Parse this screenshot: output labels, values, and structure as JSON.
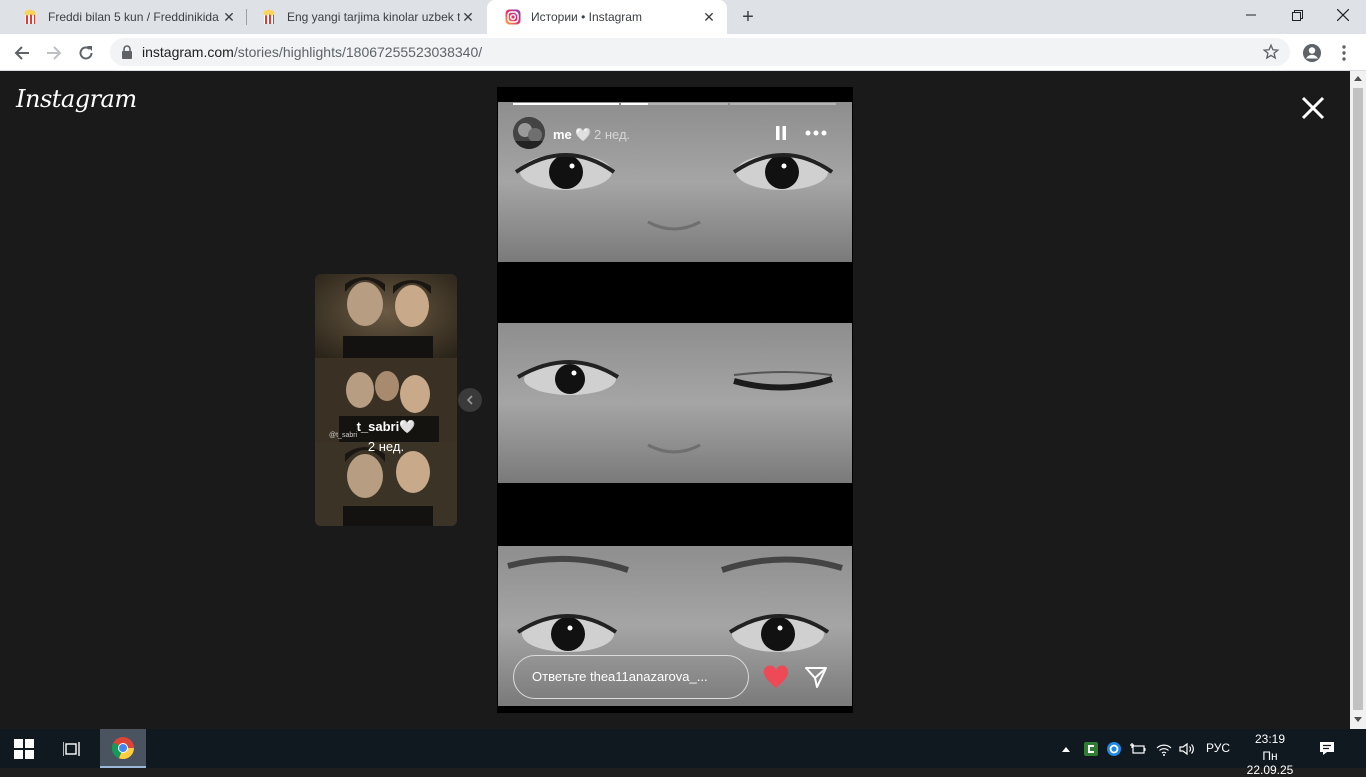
{
  "browser": {
    "tabs": [
      {
        "title": "Freddi bilan 5 kun / Freddinikida",
        "active": false
      },
      {
        "title": "Eng yangi tarjima kinolar uzbek t",
        "active": false
      },
      {
        "title": "Истории • Instagram",
        "active": true
      }
    ],
    "url_host": "instagram.com",
    "url_path": "/stories/highlights/18067255523038340/"
  },
  "instagram": {
    "logo": "Instagram",
    "preview": {
      "username": "t_sabri🤍",
      "time": "2 нед.",
      "watermark": "@t_sabri"
    },
    "story": {
      "username": "me 🤍",
      "time": "2 нед.",
      "reply_placeholder": "Ответьте thea11anazarova_...",
      "progress": [
        1.0,
        0.25,
        0.0
      ]
    }
  },
  "taskbar": {
    "language": "РУС",
    "time": "23:19",
    "date": "Пн 22.09.25"
  },
  "colors": {
    "heart": "#ed4956",
    "page_bg": "#1a1a1a",
    "taskbar_bg": "#101820"
  }
}
